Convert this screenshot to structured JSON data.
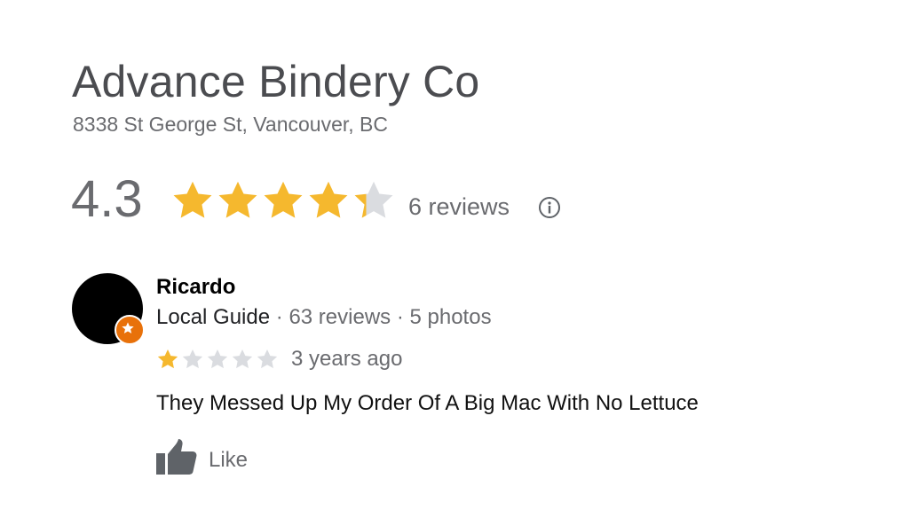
{
  "business": {
    "name": "Advance Bindery Co",
    "address": "8338 St George St, Vancouver, BC"
  },
  "rating": {
    "value": "4.3",
    "stars": 4.3,
    "max_stars": 5,
    "review_count_label": "6 reviews",
    "info_icon": "info-icon"
  },
  "review": {
    "author": "Ricardo",
    "badge": "Local Guide",
    "separator": "·",
    "author_reviews": "63 reviews",
    "author_photos": "5 photos",
    "stars": 1,
    "max_stars": 5,
    "time": "3 years ago",
    "text": "They Messed Up My Order Of A Big Mac With No Lettuce",
    "like_label": "Like"
  },
  "colors": {
    "star_filled": "#f5b82e",
    "star_empty": "#dadce0",
    "badge": "#e8710a"
  }
}
